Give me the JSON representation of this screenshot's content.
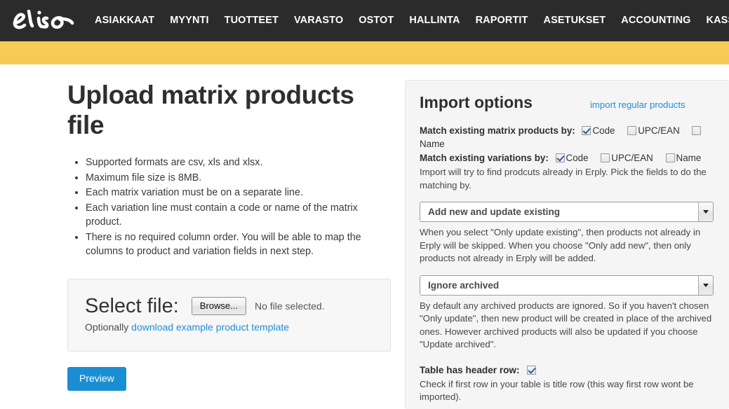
{
  "navbar": {
    "logo_text": "elisa",
    "logo_name": "elisa-logo",
    "links": [
      "ASIAKKAAT",
      "MYYNTI",
      "TUOTTEET",
      "VARASTO",
      "OSTOT",
      "HALLINTA",
      "RAPORTIT",
      "ASETUKSET",
      "ACCOUNTING",
      "KASSA"
    ],
    "search_icon": "search-icon",
    "background_color": "#2b2b2b",
    "text_color": "#ffffff"
  },
  "accent_band": {
    "color": "#f7ca54"
  },
  "main": {
    "title": "Upload matrix products file",
    "requirements": [
      "Supported formats are csv, xls and xlsx.",
      "Maximum file size is 8MB.",
      "Each matrix variation must be on a separate line.",
      "Each variation line must contain a code or name of the matrix product.",
      "There is no required column order. You will be able to map the columns to product and variation fields in next step."
    ],
    "file_panel": {
      "select_file_label": "Select file:",
      "browse_button": "Browse...",
      "no_file_text": "No file selected.",
      "optionally_prefix": "Optionally ",
      "template_link": "download example product template"
    },
    "preview_button": "Preview"
  },
  "import_options": {
    "title": "Import options",
    "header_link": "import regular products",
    "match_products": {
      "label": "Match existing matrix products by:",
      "options": [
        {
          "label": "Code",
          "checked": true
        },
        {
          "label": "UPC/EAN",
          "checked": false
        },
        {
          "label": "Name",
          "checked": false
        }
      ]
    },
    "match_variations": {
      "label": "Match existing variations by:",
      "options": [
        {
          "label": "Code",
          "checked": true
        },
        {
          "label": "UPC/EAN",
          "checked": false
        },
        {
          "label": "Name",
          "checked": false
        }
      ]
    },
    "match_hint": "Import will try to find prodcuts already in Erply. Pick the fields to do the matching by.",
    "mode_select": {
      "value": "Add new and update existing",
      "options": [
        "Add new and update existing",
        "Only update existing",
        "Only add new"
      ]
    },
    "mode_hint": "When you select \"Only update existing\", then products not already in Erply will be skipped. When you choose \"Only add new\", then only products not already in Erply will be added.",
    "archived_select": {
      "value": "Ignore archived",
      "options": [
        "Ignore archived",
        "Update archived"
      ]
    },
    "archived_hint": "By default any archived products are ignored. So if you haven't chosen \"Only update\", then new product will be created in place of the archived ones. However archived products will also be updated if you choose \"Update archived\".",
    "header_row": {
      "label": "Table has header row:",
      "checked": true,
      "hint": "Check if first row in your table is title row (this way first row wont be imported)."
    },
    "link_color": "#1e8fd5"
  }
}
